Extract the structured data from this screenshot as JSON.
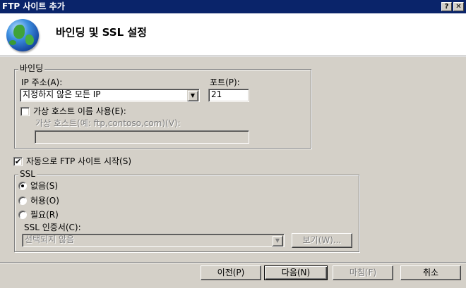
{
  "window": {
    "title": "FTP 사이트 추가",
    "help_glyph": "?",
    "close_glyph": "✕"
  },
  "header": {
    "title": "바인딩 및 SSL 설정",
    "icon": "globe-icon"
  },
  "binding": {
    "legend": "바인딩",
    "ip_label": "IP 주소(A):",
    "ip_value": "지정하지 않은 모든 IP",
    "port_label": "포트(P):",
    "port_value": "21",
    "virtual_host_checkbox_label": "가상 호스트 이름 사용(E):",
    "virtual_host_checked": false,
    "virtual_host_field_label": "가상 호스트(예: ftp,contoso,com)(V):",
    "virtual_host_value": ""
  },
  "autostart": {
    "label": "자동으로 FTP 사이트 시작(S)",
    "checked": true,
    "check_glyph": "✔"
  },
  "ssl": {
    "legend": "SSL",
    "options": [
      {
        "label": "없음(S)",
        "selected": true
      },
      {
        "label": "허용(O)",
        "selected": false
      },
      {
        "label": "필요(R)",
        "selected": false
      }
    ],
    "cert_label": "SSL 인증서(C):",
    "cert_value": "선택되지 않음",
    "view_button": "보기(W)..."
  },
  "footer": {
    "prev_button": "이전(P)",
    "next_button": "다음(N)",
    "finish_button": "마침(F)",
    "cancel_button": "취소"
  },
  "colors": {
    "title_bar": "#0a246a",
    "dialog_face": "#d4d0c8",
    "disabled_text": "#808080"
  }
}
